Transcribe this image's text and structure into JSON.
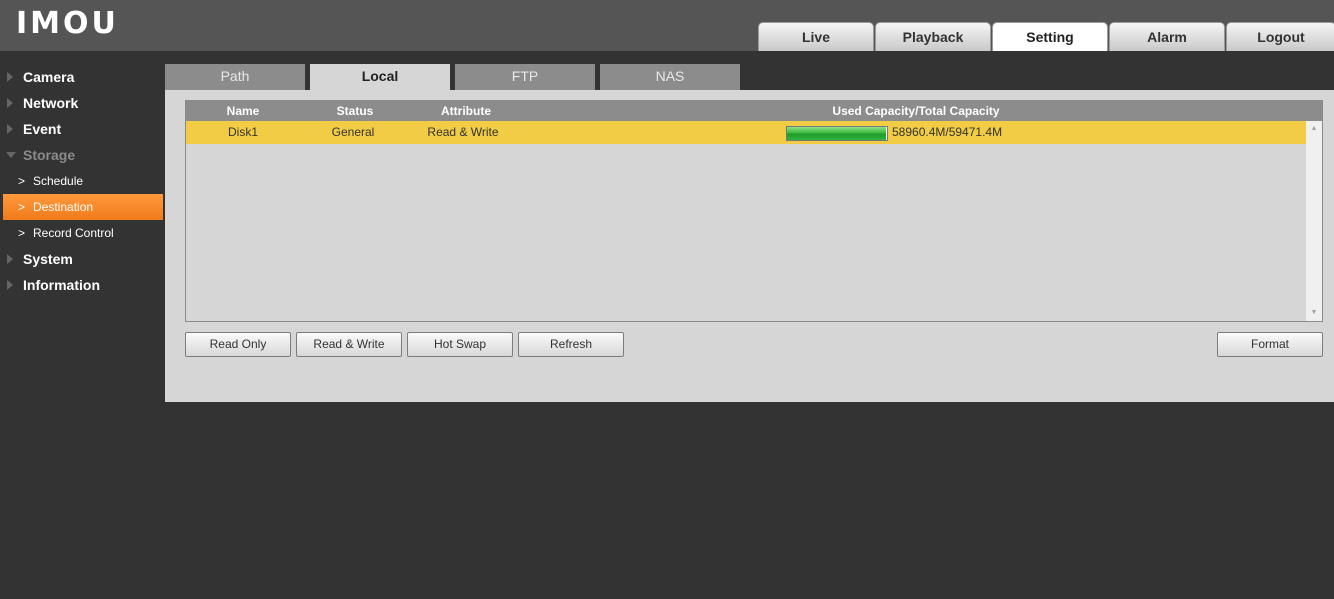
{
  "header": {
    "logo_text": "IMOU",
    "tabs": [
      {
        "label": "Live"
      },
      {
        "label": "Playback"
      },
      {
        "label": "Setting"
      },
      {
        "label": "Alarm"
      },
      {
        "label": "Logout"
      }
    ],
    "active_tab": "Setting"
  },
  "sidebar": {
    "items": [
      {
        "label": "Camera"
      },
      {
        "label": "Network"
      },
      {
        "label": "Event"
      },
      {
        "label": "Storage"
      },
      {
        "label": "Schedule"
      },
      {
        "label": "Destination"
      },
      {
        "label": "Record Control"
      },
      {
        "label": "System"
      },
      {
        "label": "Information"
      }
    ],
    "active_item": "Destination"
  },
  "subtabs": [
    {
      "label": "Path"
    },
    {
      "label": "Local"
    },
    {
      "label": "FTP"
    },
    {
      "label": "NAS"
    }
  ],
  "active_subtab": "Local",
  "table": {
    "columns": [
      "Name",
      "Status",
      "Attribute",
      "Used Capacity/Total Capacity"
    ],
    "rows": [
      {
        "name": "Disk1",
        "status": "General",
        "attribute": "Read & Write",
        "capacity": "58960.4M/59471.4M",
        "used_fraction": 0.9914
      }
    ]
  },
  "buttons": {
    "read_only": "Read Only",
    "read_write": "Read & Write",
    "hot_swap": "Hot Swap",
    "refresh": "Refresh",
    "format": "Format"
  },
  "colors": {
    "accent_orange": "#f58a2a",
    "selected_row": "#f2cc45",
    "capacity_green": "#2fb43a"
  }
}
